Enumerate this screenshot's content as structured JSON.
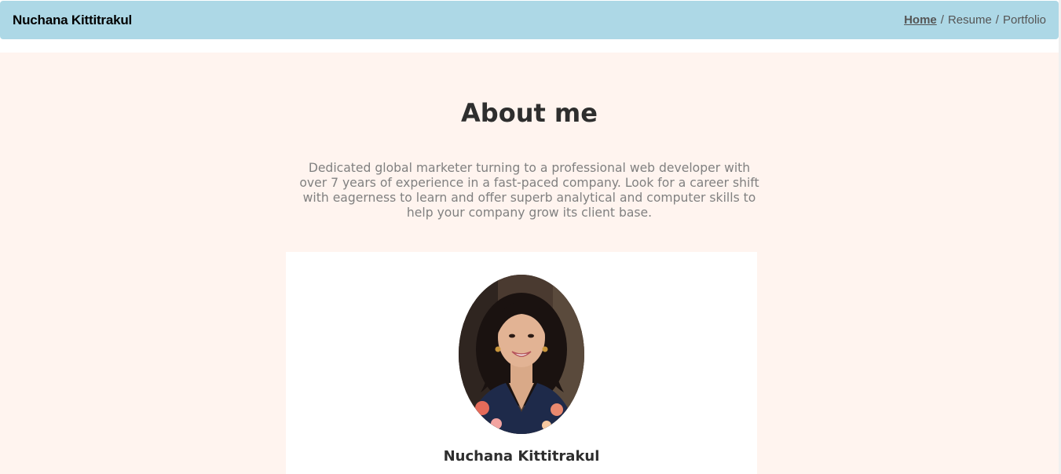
{
  "navbar": {
    "brand": "Nuchana Kittitrakul",
    "links": [
      {
        "label": "Home",
        "active": true
      },
      {
        "label": "Resume",
        "active": false
      },
      {
        "label": "Portfolio",
        "active": false
      }
    ],
    "separator": "/"
  },
  "about": {
    "title": "About me",
    "intro": "Dedicated global marketer turning to a professional web developer with over 7 years of experience in a fast-paced company. Look for a career shift with eagerness to learn and offer superb analytical and computer skills to help your company grow its client base."
  },
  "profile": {
    "name": "Nuchana Kittitrakul",
    "photo_icon": "profile-photo"
  },
  "colors": {
    "navbar_bg": "#add8e6",
    "section_bg": "#fff4ef",
    "card_bg": "#ffffff",
    "heading_text": "#2e2e2e",
    "body_text": "#808080"
  }
}
